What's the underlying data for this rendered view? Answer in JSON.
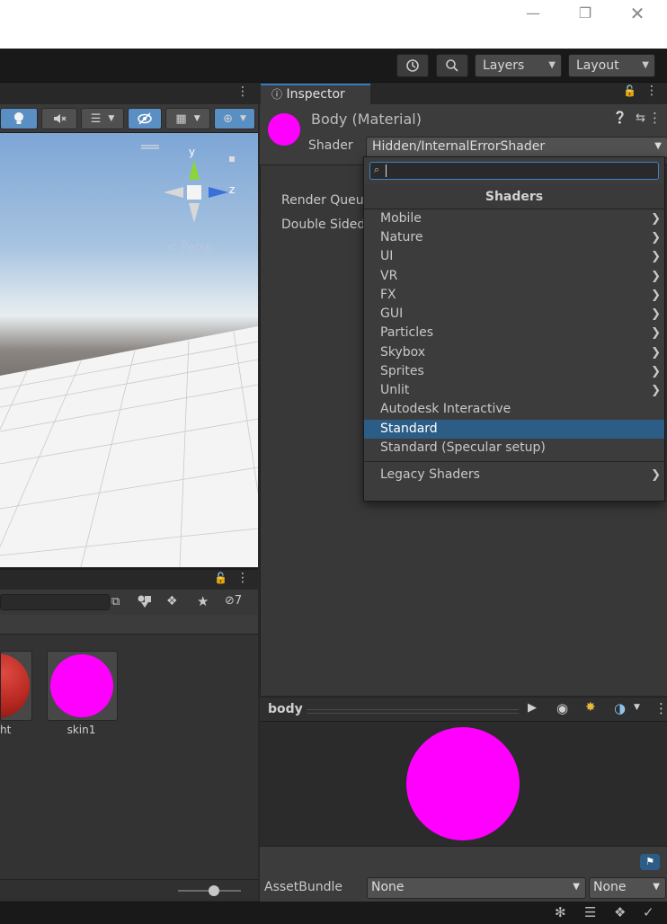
{
  "toolbar": {
    "layers": "Layers",
    "layout": "Layout"
  },
  "scene": {
    "gizmo_y": "y",
    "gizmo_z": "z",
    "persp": "Persp"
  },
  "project": {
    "hidden_count": "7",
    "assets": [
      {
        "name": "ht",
        "color": "#b3261e"
      },
      {
        "name": "skin1",
        "color": "#ff00ff"
      }
    ]
  },
  "inspector": {
    "tab": "Inspector",
    "material_name": "Body (Material)",
    "material_color": "#ff00ff",
    "shader_label": "Shader",
    "shader_value": "Hidden/InternalErrorShader",
    "render_queue_label": "Render Queue",
    "double_sided_label": "Double Sided",
    "preview_title": "body",
    "assetbundle_label": "AssetBundle",
    "assetbundle_name": "None",
    "assetbundle_variant": "None"
  },
  "shader_menu": {
    "search_value": "",
    "title": "Shaders",
    "items": [
      {
        "label": "Mobile",
        "submenu": true
      },
      {
        "label": "Nature",
        "submenu": true
      },
      {
        "label": "UI",
        "submenu": true
      },
      {
        "label": "VR",
        "submenu": true
      },
      {
        "label": "FX",
        "submenu": true
      },
      {
        "label": "GUI",
        "submenu": true
      },
      {
        "label": "Particles",
        "submenu": true
      },
      {
        "label": "Skybox",
        "submenu": true
      },
      {
        "label": "Sprites",
        "submenu": true
      },
      {
        "label": "Unlit",
        "submenu": true
      },
      {
        "label": "Autodesk Interactive",
        "submenu": false
      },
      {
        "label": "Standard",
        "submenu": false,
        "selected": true
      },
      {
        "label": "Standard (Specular setup)",
        "submenu": false
      },
      {
        "label": "Legacy Shaders",
        "submenu": true
      }
    ]
  },
  "colors": {
    "accent": "#3a79bb",
    "selection": "#2c5d87",
    "error_magenta": "#ff00ff"
  }
}
